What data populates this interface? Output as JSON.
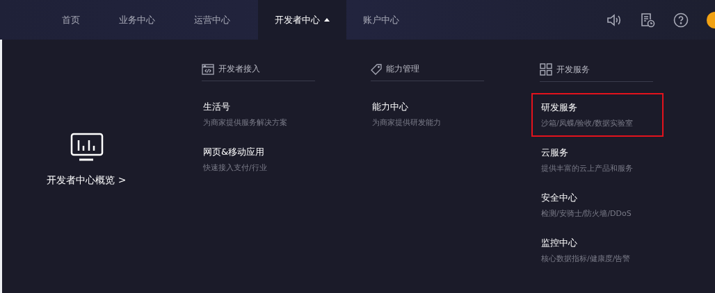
{
  "nav": [
    {
      "label": "首页",
      "selected": false,
      "expanded": false
    },
    {
      "label": "业务中心",
      "selected": false,
      "expanded": false
    },
    {
      "label": "运营中心",
      "selected": false,
      "expanded": false
    },
    {
      "label": "开发者中心",
      "selected": true,
      "expanded": true
    },
    {
      "label": "账户中心",
      "selected": false,
      "expanded": false
    }
  ],
  "toolbar": [
    {
      "kind": "sound"
    },
    {
      "kind": "document-clock"
    },
    {
      "kind": "help"
    },
    {
      "kind": "avatar"
    }
  ],
  "menu": {
    "overview": {
      "label": "开发者中心概览 >"
    },
    "columns": [
      {
        "kind": "code",
        "title": "开发者接入",
        "items": [
          {
            "title": "生活号",
            "desc": "为商家提供服务解决方案",
            "highlighted": false
          },
          {
            "title": "网页&移动应用",
            "desc": "快速接入支付/行业",
            "highlighted": false
          }
        ]
      },
      {
        "kind": "tag",
        "title": "能力管理",
        "items": [
          {
            "title": "能力中心",
            "desc": "为商家提供研发能力",
            "highlighted": false
          }
        ]
      },
      {
        "kind": "grid",
        "title": "开发服务",
        "items": [
          {
            "title": "研发服务",
            "desc": "沙箱/凤蝶/验收/数据实验室",
            "highlighted": true
          },
          {
            "title": "云服务",
            "desc": "提供丰富的云上产品和服务",
            "highlighted": false
          },
          {
            "title": "安全中心",
            "desc": "检测/安骑士/防火墙/DDoS",
            "highlighted": false
          },
          {
            "title": "监控中心",
            "desc": "核心数据指标/健康度/告警",
            "highlighted": false
          }
        ]
      }
    ]
  }
}
